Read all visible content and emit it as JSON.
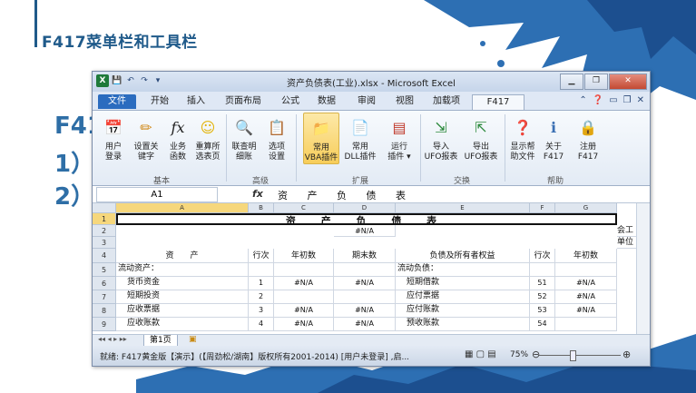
{
  "slide": {
    "title": "F417菜单栏和工具栏",
    "bg_text": [
      "F41",
      "1）",
      "2）"
    ]
  },
  "window": {
    "title": "资产负债表(工业).xlsx - Microsoft Excel",
    "app_icon": "X",
    "qat": [
      "save",
      "undo",
      "redo",
      "customize"
    ]
  },
  "tabs": {
    "items": [
      "文件",
      "开始",
      "插入",
      "页面布局",
      "公式",
      "数据",
      "审阅",
      "视图",
      "加载项",
      "F417"
    ],
    "active": "F417"
  },
  "ribbon": {
    "groups": [
      {
        "label": "基本",
        "buttons": [
          {
            "label1": "用户",
            "label2": "登录",
            "icon": "calendar-icon"
          },
          {
            "label1": "设置关",
            "label2": "键字",
            "icon": "pencil-icon"
          },
          {
            "label1": "业务",
            "label2": "函数",
            "icon": "fx-icon"
          },
          {
            "label1": "重算所",
            "label2": "选表页",
            "icon": "smiley-icon"
          }
        ]
      },
      {
        "label": "高级",
        "buttons": [
          {
            "label1": "联查明",
            "label2": "细账",
            "icon": "search-doc-icon"
          },
          {
            "label1": "选项",
            "label2": "设置",
            "icon": "settings-doc-icon"
          }
        ]
      },
      {
        "label": "扩展",
        "buttons": [
          {
            "label1": "常用",
            "label2": "VBA插件",
            "icon": "folder-icon"
          },
          {
            "label1": "常用",
            "label2": "DLL插件",
            "icon": "doc-gear-icon"
          },
          {
            "label1": "运行",
            "label2": "插件 ▾",
            "icon": "run-icon"
          }
        ]
      },
      {
        "label": "交换",
        "buttons": [
          {
            "label1": "导入",
            "label2": "UFO报表",
            "icon": "import-icon"
          },
          {
            "label1": "导出",
            "label2": "UFO报表",
            "icon": "export-icon"
          }
        ]
      },
      {
        "label": "帮助",
        "buttons": [
          {
            "label1": "显示帮",
            "label2": "助文件",
            "icon": "help-book-icon"
          },
          {
            "label1": "关于",
            "label2": "F417",
            "icon": "info-icon"
          },
          {
            "label1": "注册",
            "label2": "F417",
            "icon": "lock-icon"
          }
        ]
      }
    ]
  },
  "formula_bar": {
    "name_box": "A1",
    "fx": "fx",
    "content": "资 产 负 债 表"
  },
  "sheet": {
    "columns": [
      "A",
      "B",
      "C",
      "D",
      "E",
      "F",
      "G"
    ],
    "rows": [
      "1",
      "2",
      "3",
      "4",
      "5",
      "6",
      "7",
      "8",
      "9"
    ],
    "title": "资 产 负 债 表",
    "na": "#N/A",
    "h_asset": "资　　产",
    "h_row": "行次",
    "h_begin": "年初数",
    "h_end": "期末数",
    "h_liab": "负债及所有者权益",
    "company": "会工",
    "unit": "单位",
    "left_rows": [
      {
        "name": "流动资产：",
        "no": "",
        "begin": "",
        "end": ""
      },
      {
        "name": "货币资金",
        "no": "1",
        "begin": "#N/A",
        "end": "#N/A"
      },
      {
        "name": "短期投资",
        "no": "2",
        "begin": "",
        "end": ""
      },
      {
        "name": "应收票据",
        "no": "3",
        "begin": "#N/A",
        "end": "#N/A"
      },
      {
        "name": "应收账款",
        "no": "4",
        "begin": "#N/A",
        "end": "#N/A"
      }
    ],
    "right_rows": [
      {
        "name": "流动负债：",
        "no": "",
        "begin": ""
      },
      {
        "name": "短期借款",
        "no": "51",
        "begin": "#N/A"
      },
      {
        "name": "应付票据",
        "no": "52",
        "begin": "#N/A"
      },
      {
        "name": "应付账款",
        "no": "53",
        "begin": "#N/A"
      },
      {
        "name": "预收账款",
        "no": "54",
        "begin": ""
      }
    ],
    "sheet_tab": "第1页"
  },
  "status": {
    "text": "就绪: F417黄金版【演示】(【周劲松/湖南】版权所有2001-2014) [用户未登录] ,启...",
    "zoom": "75%"
  }
}
